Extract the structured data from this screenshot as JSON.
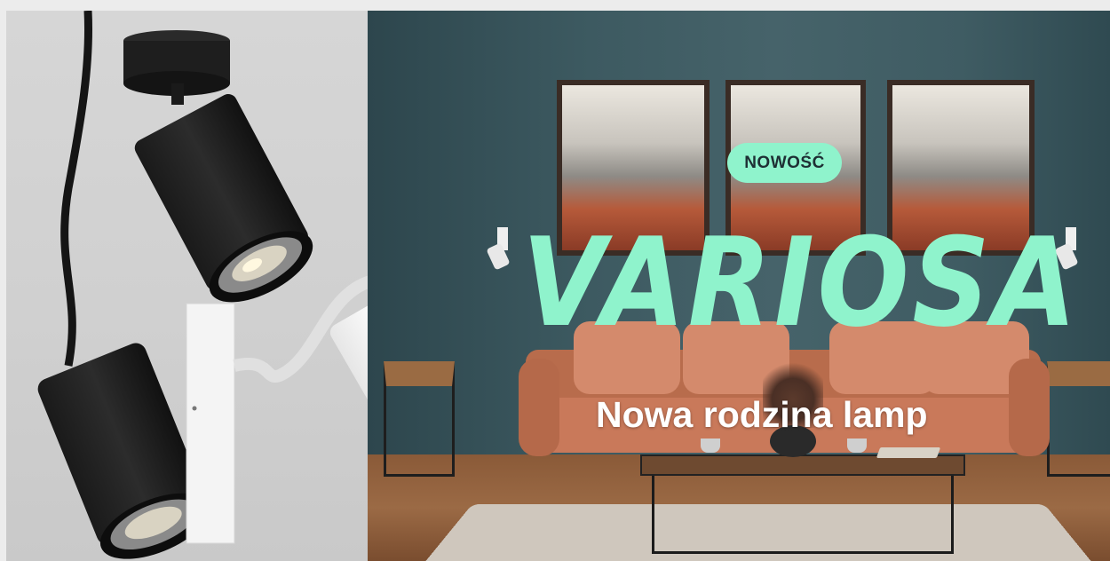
{
  "banner": {
    "badge": "NOWOŚĆ",
    "title": "VARIOSA",
    "subtitle": "Nowa rodzina lamp",
    "accent_color": "#8ff3cc",
    "wall_color": "#3d5a61"
  },
  "icons": [
    "ceiling-spotlight-icon",
    "wall-spotlight-icon",
    "pendant-cable-icon"
  ]
}
